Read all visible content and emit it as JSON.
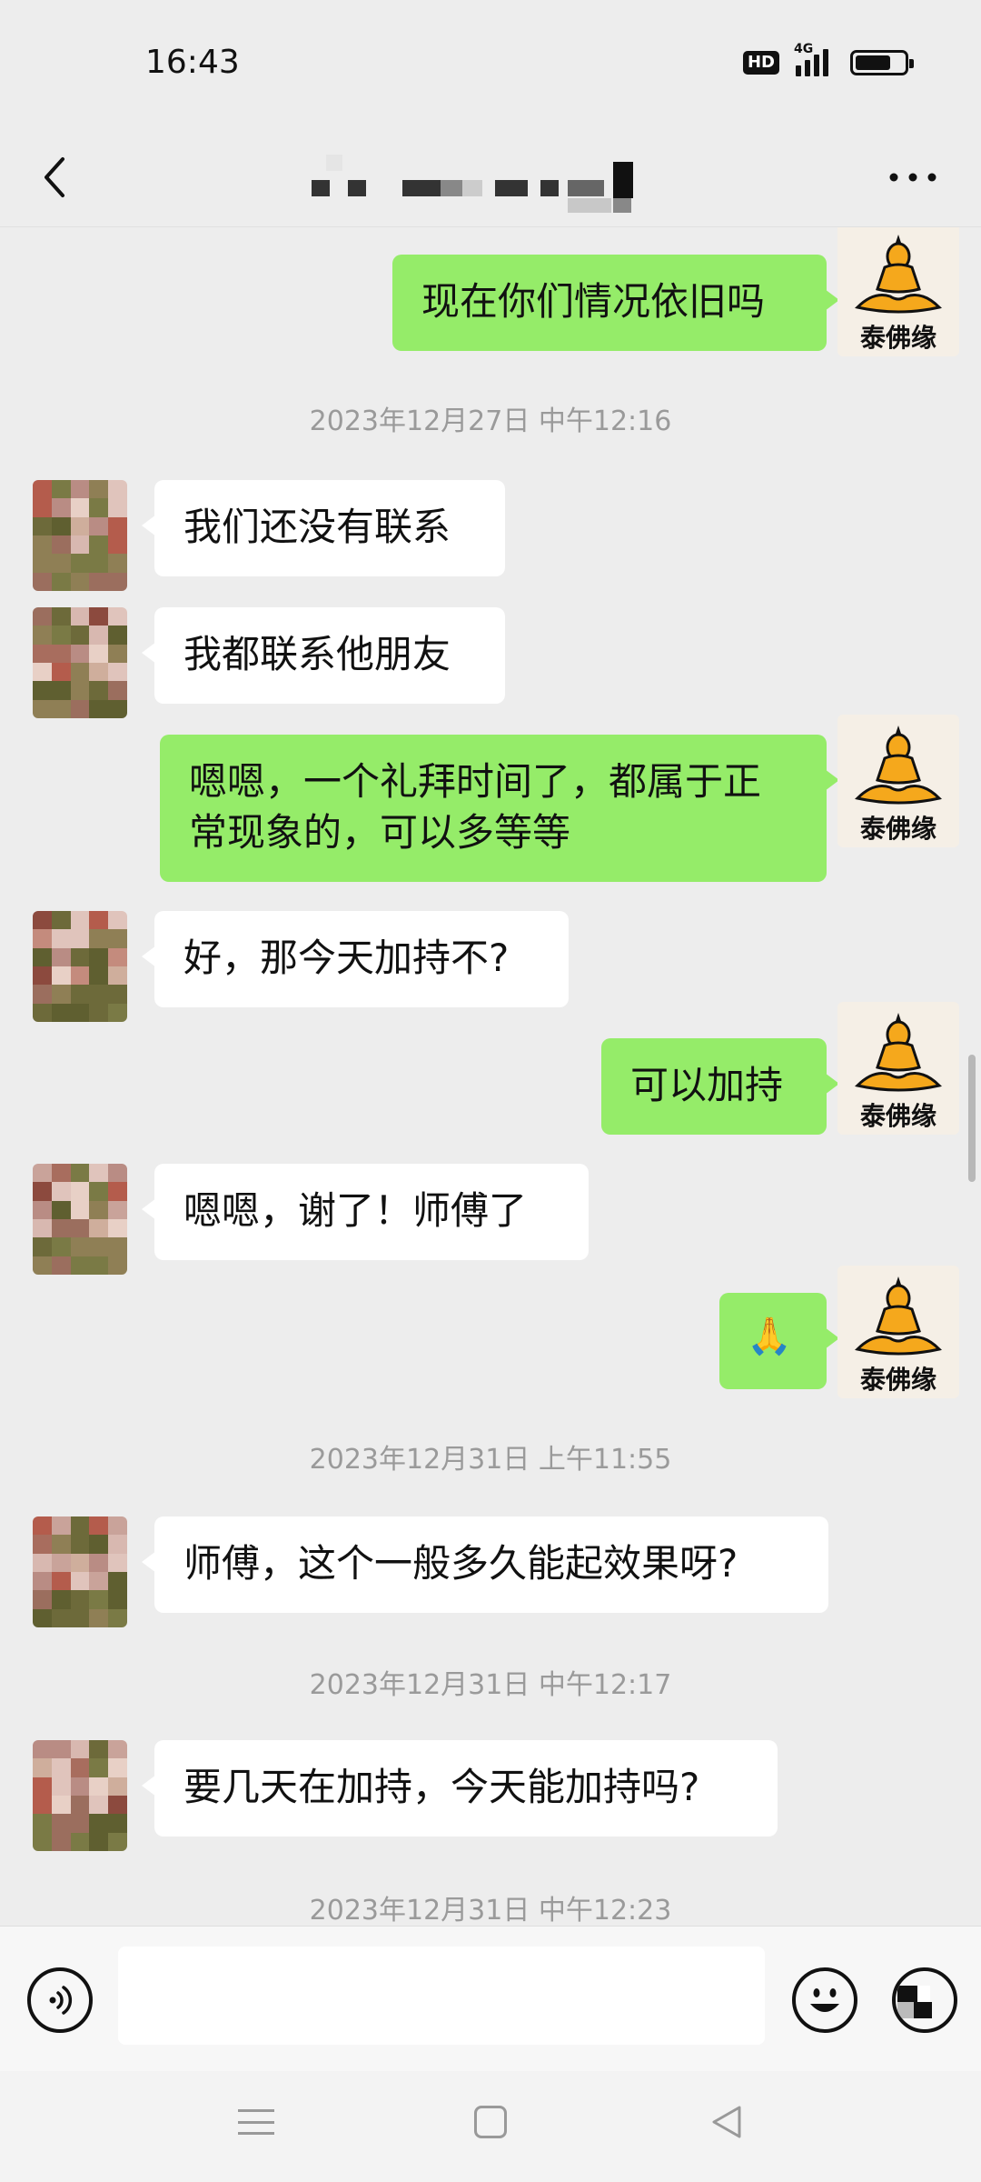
{
  "status_bar": {
    "time": "16:43",
    "hd_label": "HD",
    "network_label": "4G",
    "battery_level": 0.66,
    "icons": [
      "hd-icon",
      "signal-4g-icon",
      "battery-icon"
    ]
  },
  "header": {
    "title": "",
    "back_icon": "chevron-left-icon",
    "more_icon": "more-dots-icon"
  },
  "contact_avatar_note": "mosaic-blurred",
  "self_avatar": {
    "label": "泰佛缘",
    "icon": "buddha-icon",
    "color": "#f5a81c"
  },
  "messages": [
    {
      "type": "text",
      "from": "self",
      "text": "现在你们情况依旧吗"
    },
    {
      "type": "time",
      "text": "2023年12月27日 中午12:16"
    },
    {
      "type": "text",
      "from": "contact",
      "text": "我们还没有联系"
    },
    {
      "type": "text",
      "from": "contact",
      "text": "我都联系他朋友"
    },
    {
      "type": "text",
      "from": "self",
      "text": "嗯嗯，一个礼拜时间了，都属于正常现象的，可以多等等"
    },
    {
      "type": "text",
      "from": "contact",
      "text": "好，那今天加持不?"
    },
    {
      "type": "text",
      "from": "self",
      "text": "可以加持"
    },
    {
      "type": "text",
      "from": "contact",
      "text": "嗯嗯，谢了！师傅了"
    },
    {
      "type": "emoji",
      "from": "self",
      "text": "🙏"
    },
    {
      "type": "time",
      "text": "2023年12月31日 上午11:55"
    },
    {
      "type": "text",
      "from": "contact",
      "text": "师傅，这个一般多久能起效果呀?"
    },
    {
      "type": "time",
      "text": "2023年12月31日 中午12:17"
    },
    {
      "type": "text",
      "from": "contact",
      "text": "要几天在加持，今天能加持吗?"
    },
    {
      "type": "time",
      "text": "2023年12月31日 中午12:23"
    }
  ],
  "input_bar": {
    "input_value": "",
    "voice_icon": "voice-icon",
    "emoji_icon": "emoji-icon",
    "plus_icon": "plus-icon"
  },
  "system_nav": {
    "icons": [
      "menu-icon",
      "home-icon",
      "back-triangle-icon"
    ]
  },
  "colors": {
    "background": "#ededed",
    "outgoing_bubble": "#95ec69",
    "incoming_bubble": "#ffffff",
    "timestamp_text": "#9a9a9a"
  }
}
